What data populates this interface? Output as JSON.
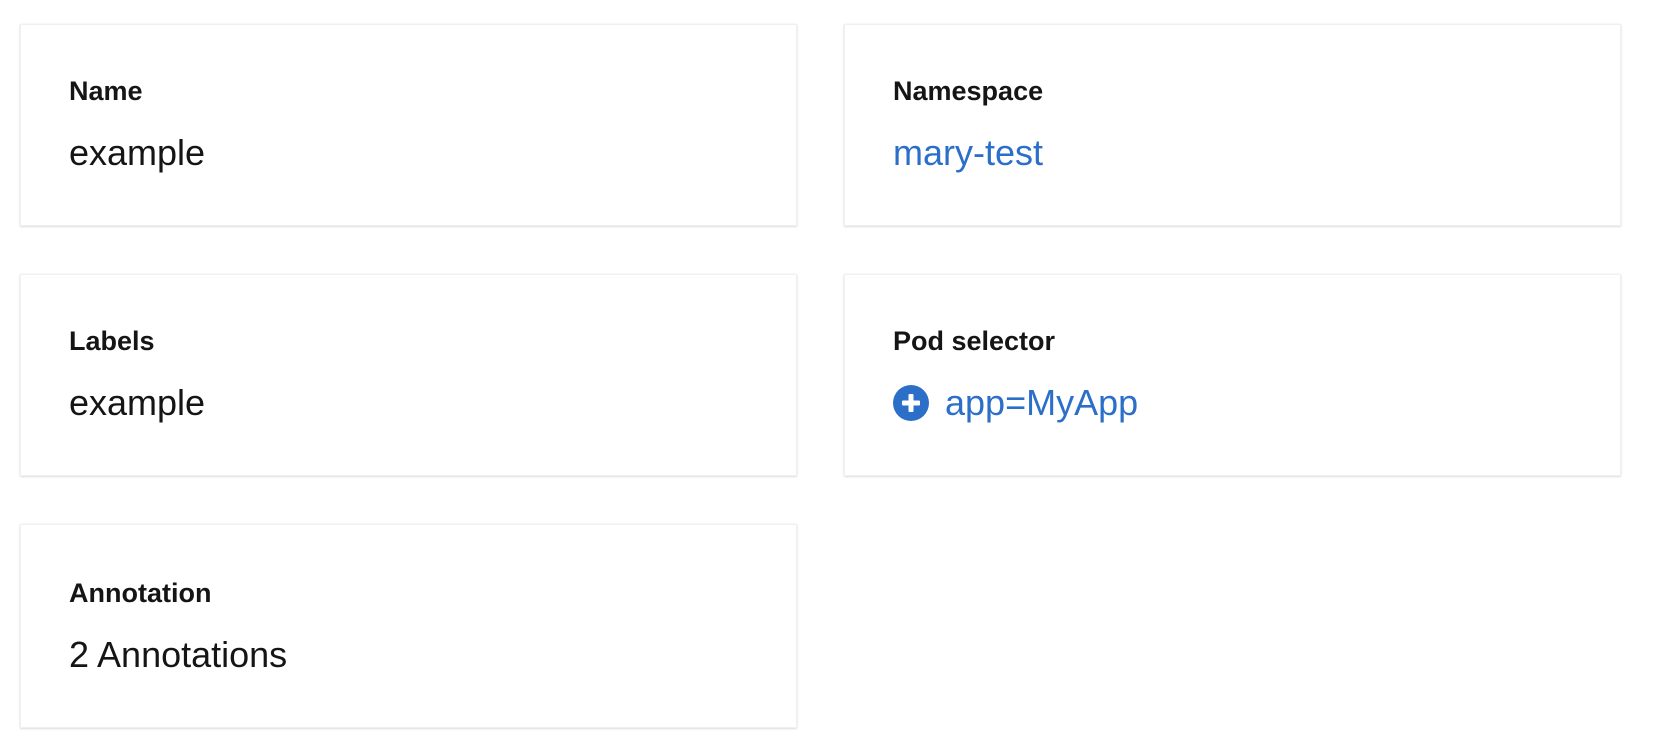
{
  "details": {
    "name": {
      "label": "Name",
      "value": "example"
    },
    "namespace": {
      "label": "Namespace",
      "value": "mary-test"
    },
    "labels": {
      "label": "Labels",
      "value": "example"
    },
    "pod_selector": {
      "label": "Pod selector",
      "value": "app=MyApp",
      "icon": "plus-circle-icon"
    },
    "annotation": {
      "label": "Annotation",
      "value": "2 Annotations"
    }
  },
  "colors": {
    "link": "#2c6fc9",
    "text": "#151515",
    "card_background": "#ffffff"
  }
}
